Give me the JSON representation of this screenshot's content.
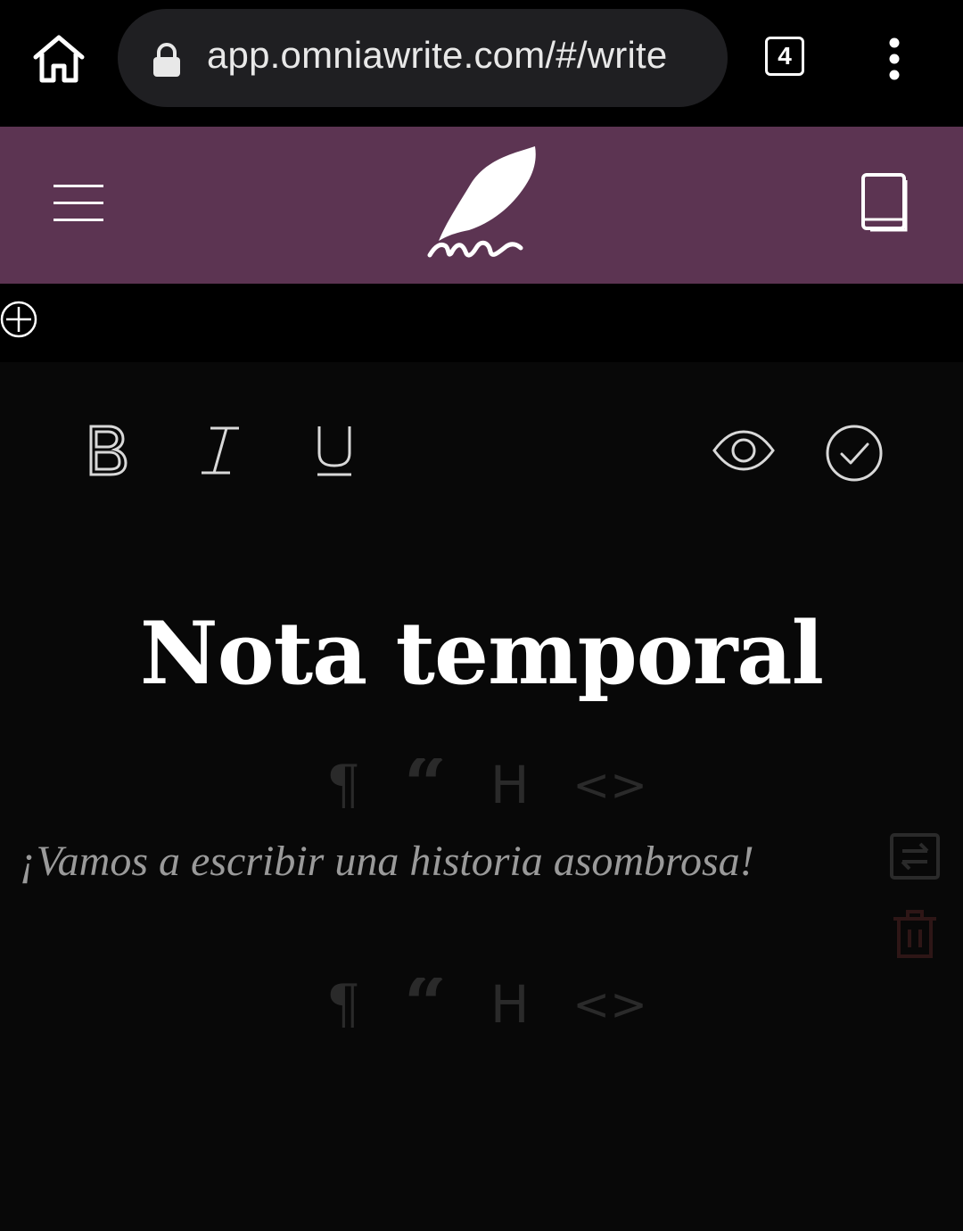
{
  "browser": {
    "url": "app.omniawrite.com/#/write",
    "tab_count": "4"
  },
  "header": {
    "logo_icon": "quill-icon",
    "background": "#5c3452"
  },
  "toolbar": {
    "bold_icon": "bold-icon",
    "italic_icon": "italic-icon",
    "underline_icon": "underline-icon",
    "preview_icon": "eye-icon",
    "done_icon": "check-circle-icon"
  },
  "document": {
    "title": "Nota temporal",
    "placeholder": "¡Vamos a escribir una historia asombrosa!"
  },
  "block_bar": {
    "paragraph": "¶",
    "quote": "“",
    "heading": "H",
    "code": "<>"
  }
}
